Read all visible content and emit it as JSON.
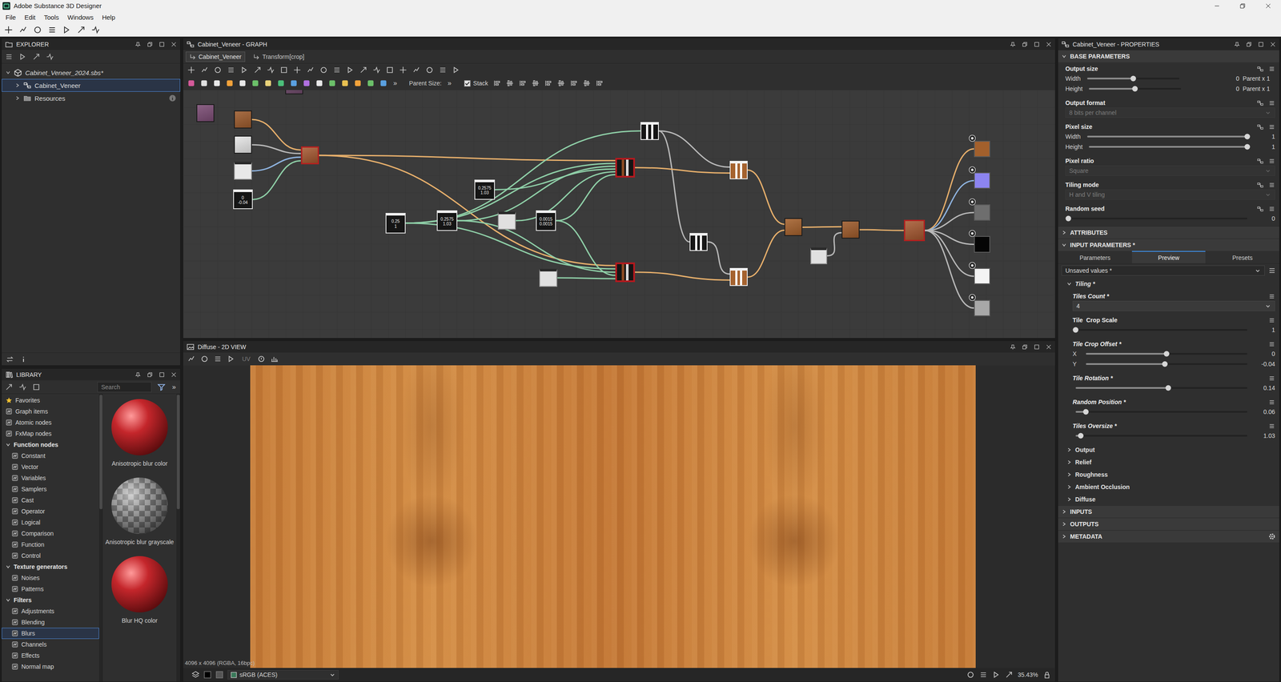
{
  "window": {
    "title": "Adobe Substance 3D Designer"
  },
  "menu": [
    "File",
    "Edit",
    "Tools",
    "Windows",
    "Help"
  ],
  "explorer": {
    "title": "EXPLORER",
    "items": [
      {
        "label": "Cabinet_Veneer_2024.sbs*",
        "kind": "package",
        "expanded": true,
        "selected": false,
        "children": [
          {
            "label": "Cabinet_Veneer",
            "kind": "graph",
            "expanded": false,
            "selected": true
          },
          {
            "label": "Resources",
            "kind": "folder",
            "expanded": false,
            "selected": false
          }
        ]
      }
    ]
  },
  "library": {
    "title": "LIBRARY",
    "search": {
      "placeholder": "Search"
    },
    "more": "»",
    "tree": [
      {
        "label": "Favorites",
        "kind": "favorites",
        "expanded": false,
        "selected": false
      },
      {
        "label": "Graph items",
        "kind": "item",
        "expanded": false,
        "selected": false
      },
      {
        "label": "Atomic nodes",
        "kind": "item",
        "expanded": false,
        "selected": false
      },
      {
        "label": "FxMap nodes",
        "kind": "item",
        "expanded": false,
        "selected": false
      },
      {
        "label": "Function nodes",
        "kind": "group",
        "expanded": true,
        "selected": false,
        "children": [
          {
            "label": "Constant",
            "kind": "item",
            "expanded": false,
            "selected": false
          },
          {
            "label": "Vector",
            "kind": "item",
            "expanded": false,
            "selected": false
          },
          {
            "label": "Variables",
            "kind": "item",
            "expanded": false,
            "selected": false
          },
          {
            "label": "Samplers",
            "kind": "item",
            "expanded": false,
            "selected": false
          },
          {
            "label": "Cast",
            "kind": "item",
            "expanded": false,
            "selected": false
          },
          {
            "label": "Operator",
            "kind": "item",
            "expanded": false,
            "selected": false
          },
          {
            "label": "Logical",
            "kind": "item",
            "expanded": false,
            "selected": false
          },
          {
            "label": "Comparison",
            "kind": "item",
            "expanded": false,
            "selected": false
          },
          {
            "label": "Function",
            "kind": "item",
            "expanded": false,
            "selected": false
          },
          {
            "label": "Control",
            "kind": "item",
            "expanded": false,
            "selected": false
          }
        ]
      },
      {
        "label": "Texture generators",
        "kind": "group",
        "expanded": true,
        "selected": false,
        "children": [
          {
            "label": "Noises",
            "kind": "item",
            "expanded": false,
            "selected": false
          },
          {
            "label": "Patterns",
            "kind": "item",
            "expanded": false,
            "selected": false
          }
        ]
      },
      {
        "label": "Filters",
        "kind": "group",
        "expanded": true,
        "selected": false,
        "children": [
          {
            "label": "Adjustments",
            "kind": "item",
            "expanded": false,
            "selected": false
          },
          {
            "label": "Blending",
            "kind": "item",
            "expanded": false,
            "selected": false
          },
          {
            "label": "Blurs",
            "kind": "item",
            "expanded": false,
            "selected": true
          },
          {
            "label": "Channels",
            "kind": "item",
            "expanded": false,
            "selected": false
          },
          {
            "label": "Effects",
            "kind": "item",
            "expanded": false,
            "selected": false
          },
          {
            "label": "Normal map",
            "kind": "item",
            "expanded": false,
            "selected": false
          }
        ]
      }
    ],
    "thumbs": [
      {
        "label": "Anisotropic blur color",
        "kind": "color",
        "color": "#c4262b"
      },
      {
        "label": "Anisotropic blur grayscale",
        "kind": "grayscale",
        "color": "#9a9a9a"
      },
      {
        "label": "Blur HQ color",
        "kind": "color",
        "color": "#c4262b"
      }
    ]
  },
  "graph": {
    "title": "Cabinet_Veneer - GRAPH",
    "breadcrumbs": [
      {
        "label": "Cabinet_Veneer",
        "selected": true
      },
      {
        "label": "Transform[crop]",
        "selected": false
      }
    ],
    "toolbar": {
      "more": "»",
      "parent_size": "Parent Size:",
      "parent_more": "»",
      "stack": {
        "label": "Stack",
        "checked": true
      }
    },
    "nodes": [
      {
        "kind": "thumb",
        "color": "#7b4c74"
      },
      {
        "kind": "thumb",
        "color": "#6e4a6a"
      },
      {
        "kind": "thumb",
        "color": "#9b5a2c"
      },
      {
        "kind": "thumb",
        "color": "#e6e6e6"
      },
      {
        "kind": "blank",
        "color": "#e8e8e8"
      },
      {
        "kind": "value",
        "color": "#151515",
        "lines": [
          "0",
          "-0.04"
        ]
      },
      {
        "kind": "framed",
        "color": "#a4562e"
      },
      {
        "kind": "value",
        "color": "#151515",
        "lines": [
          "0.25",
          "1"
        ]
      },
      {
        "kind": "value",
        "color": "#151515",
        "lines": [
          "0.2575",
          "1.03"
        ]
      },
      {
        "kind": "value",
        "color": "#151515",
        "lines": [
          "0.2575",
          "1.03"
        ]
      },
      {
        "kind": "blank",
        "color": "#e0e0e0"
      },
      {
        "kind": "value",
        "color": "#151515",
        "lines": [
          "0.0015",
          "0.0015"
        ]
      },
      {
        "kind": "blank",
        "color": "#e0e0e0"
      },
      {
        "kind": "stripes",
        "color": "#151515"
      },
      {
        "kind": "stripes",
        "color": "#151515"
      },
      {
        "kind": "transform",
        "color": "#151515"
      },
      {
        "kind": "transform",
        "color": "#151515"
      },
      {
        "kind": "stripes",
        "color": "#a5622e"
      },
      {
        "kind": "stripes",
        "color": "#a5622e"
      },
      {
        "kind": "thumb",
        "color": "#a3602c"
      },
      {
        "kind": "thumb",
        "color": "#9d5a2a"
      },
      {
        "kind": "blank",
        "color": "#e0e0e0"
      },
      {
        "kind": "framed",
        "color": "#a4562e"
      },
      {
        "kind": "output",
        "color": "#a3602c"
      },
      {
        "kind": "output",
        "color": "#8c84f0"
      },
      {
        "kind": "output",
        "color": "#6e6e6e"
      },
      {
        "kind": "output",
        "color": "#050505"
      },
      {
        "kind": "output",
        "color": "#f4f4f4"
      },
      {
        "kind": "output",
        "color": "#a8a8a8"
      }
    ]
  },
  "view2d": {
    "title": "Diffuse - 2D VIEW",
    "uv": {
      "label": "UV",
      "disabled": true
    },
    "status": "4096 x 4096 (RGBA, 16bpc)",
    "color_space": "sRGB (ACES)",
    "zoom": "35.43%"
  },
  "properties": {
    "title": "Cabinet_Veneer - PROPERTIES",
    "sections": [
      {
        "title": "BASE PARAMETERS",
        "kind": "base",
        "expanded": true,
        "groups": [
          {
            "label": "Output size",
            "modified": false,
            "rows": [
              {
                "kind": "size",
                "label": "Width",
                "level": 0.5,
                "value": "0",
                "unit": "Parent x 1"
              },
              {
                "kind": "size",
                "label": "Height",
                "level": 0.5,
                "value": "0",
                "unit": "Parent x 1"
              }
            ]
          },
          {
            "label": "Output format",
            "modified": false,
            "rows": [
              {
                "kind": "select",
                "label": "",
                "value": "8 bits per channel",
                "disabled": true
              }
            ]
          },
          {
            "label": "Pixel size",
            "modified": false,
            "rows": [
              {
                "kind": "slider",
                "label": "Width",
                "level": 1,
                "value": "1"
              },
              {
                "kind": "slider",
                "label": "Height",
                "level": 1,
                "value": "1"
              }
            ]
          },
          {
            "label": "Pixel ratio",
            "modified": false,
            "rows": [
              {
                "kind": "select",
                "label": "",
                "value": "Square",
                "disabled": true
              }
            ]
          },
          {
            "label": "Tiling mode",
            "modified": false,
            "rows": [
              {
                "kind": "select",
                "label": "",
                "value": "H and V tiling",
                "disabled": true
              }
            ]
          },
          {
            "label": "Random seed",
            "modified": false,
            "rows": [
              {
                "kind": "slider",
                "label": "",
                "level": 0,
                "value": "0"
              }
            ]
          }
        ]
      },
      {
        "title": "ATTRIBUTES",
        "kind": "plain",
        "expanded": false
      },
      {
        "title": "INPUT PARAMETERS *",
        "kind": "input",
        "expanded": true,
        "tabs": [
          {
            "label": "Parameters",
            "selected": false
          },
          {
            "label": "Preview",
            "selected": true
          },
          {
            "label": "Presets",
            "selected": false
          }
        ],
        "preset": "Unsaved values *",
        "groups": [
          {
            "label": "Tiling *",
            "modified": true,
            "expanded": true,
            "params": [
              {
                "label": "Tiles Count *",
                "modified": true,
                "rows": [
                  {
                    "kind": "select",
                    "label": "",
                    "value": "4",
                    "disabled": false
                  }
                ]
              },
              {
                "label": "Tile  Crop Scale",
                "modified": false,
                "rows": [
                  {
                    "kind": "slider",
                    "label": "",
                    "level": 0,
                    "value": "1"
                  }
                ]
              },
              {
                "label": "Tile Crop Offset *",
                "modified": true,
                "rows": [
                  {
                    "kind": "slider",
                    "label": "X",
                    "level": 0.5,
                    "value": "0"
                  },
                  {
                    "kind": "slider",
                    "label": "Y",
                    "level": 0.49,
                    "value": "-0.04"
                  }
                ]
              },
              {
                "label": "Tile Rotation *",
                "modified": true,
                "rows": [
                  {
                    "kind": "slider",
                    "label": "",
                    "level": 0.54,
                    "value": "0.14"
                  }
                ]
              },
              {
                "label": "Random Position *",
                "modified": true,
                "rows": [
                  {
                    "kind": "slider",
                    "label": "",
                    "level": 0.06,
                    "value": "0.06"
                  }
                ]
              },
              {
                "label": "Tiles Oversize *",
                "modified": true,
                "rows": [
                  {
                    "kind": "slider",
                    "label": "",
                    "level": 0.03,
                    "value": "1.03"
                  }
                ]
              }
            ]
          },
          {
            "label": "Output",
            "modified": false,
            "expanded": false,
            "params": []
          },
          {
            "label": "Relief",
            "modified": false,
            "expanded": false,
            "params": []
          },
          {
            "label": "Roughness",
            "modified": false,
            "expanded": false,
            "params": []
          },
          {
            "label": "Ambient Occlusion",
            "modified": false,
            "expanded": false,
            "params": []
          },
          {
            "label": "Diffuse",
            "modified": false,
            "expanded": false,
            "params": []
          }
        ]
      },
      {
        "title": "INPUTS",
        "kind": "plain",
        "expanded": false
      },
      {
        "title": "OUTPUTS",
        "kind": "plain",
        "expanded": false
      },
      {
        "title": "METADATA",
        "kind": "metadata",
        "expanded": false
      }
    ]
  }
}
